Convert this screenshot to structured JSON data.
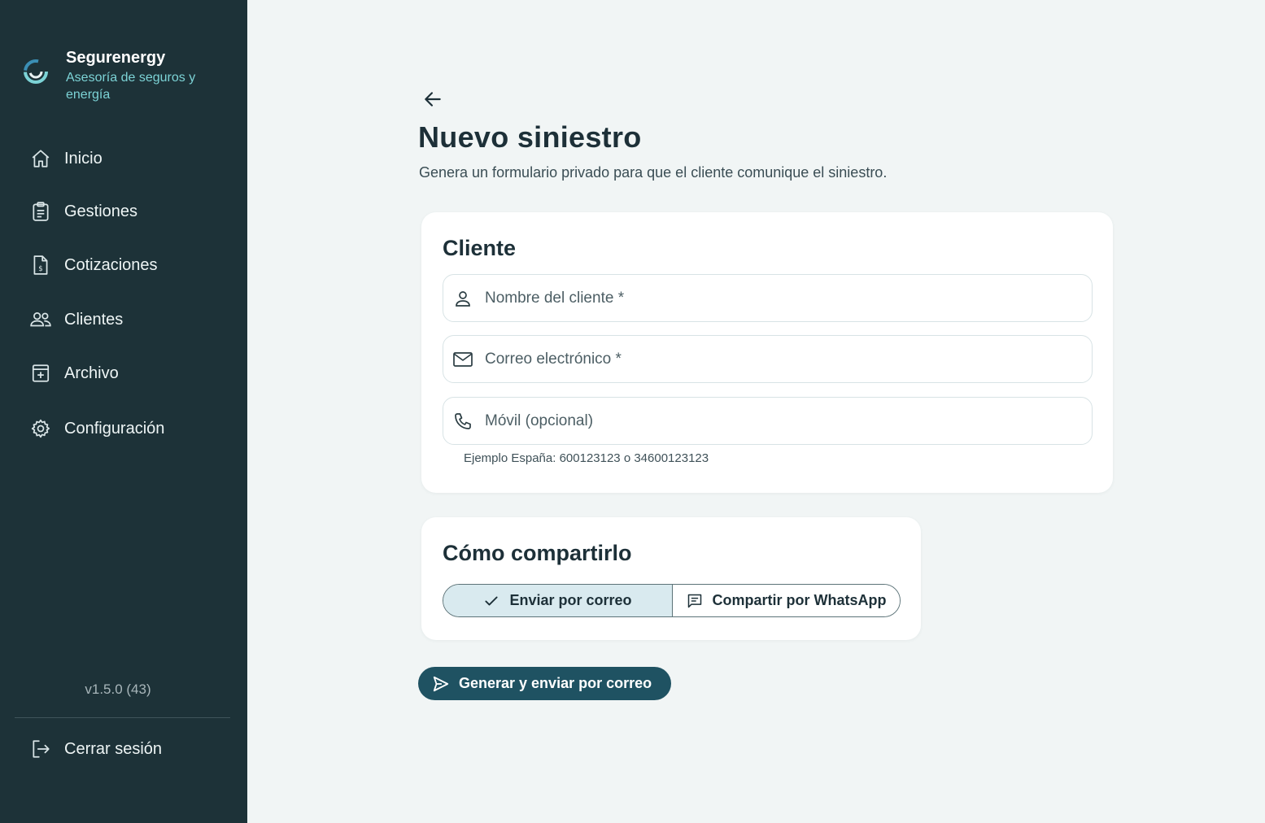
{
  "brand": {
    "name": "Segurenergy",
    "subtitle": "Asesoría de seguros y energía"
  },
  "sidebar": {
    "items": [
      {
        "label": "Inicio",
        "icon": "home-icon"
      },
      {
        "label": "Gestiones",
        "icon": "clipboard-icon"
      },
      {
        "label": "Cotizaciones",
        "icon": "invoice-icon"
      },
      {
        "label": "Clientes",
        "icon": "users-icon"
      },
      {
        "label": "Archivo",
        "icon": "archive-icon"
      },
      {
        "label": "Configuración",
        "icon": "gear-icon"
      }
    ],
    "version": "v1.5.0 (43)",
    "logout_label": "Cerrar sesión"
  },
  "page": {
    "title": "Nuevo siniestro",
    "description": "Genera un formulario privado para que el cliente comunique el siniestro."
  },
  "client_card": {
    "title": "Cliente",
    "name_placeholder": "Nombre del cliente *",
    "name_value": "",
    "email_placeholder": "Correo electrónico *",
    "email_value": "",
    "phone_placeholder": "Móvil (opcional)",
    "phone_value": "",
    "phone_hint": "Ejemplo España: 600123123 o 34600123123"
  },
  "share_card": {
    "title": "Cómo compartirlo",
    "options": [
      {
        "label": "Enviar por correo",
        "selected": true
      },
      {
        "label": "Compartir por WhatsApp",
        "selected": false
      }
    ]
  },
  "submit": {
    "label": "Generar y enviar por correo"
  },
  "colors": {
    "sidebar_bg": "#1d3238",
    "accent": "#1f5262",
    "brand_sub": "#7cd3d6",
    "selected_segment": "#d9eaef",
    "page_bg": "#f1f5f5"
  }
}
